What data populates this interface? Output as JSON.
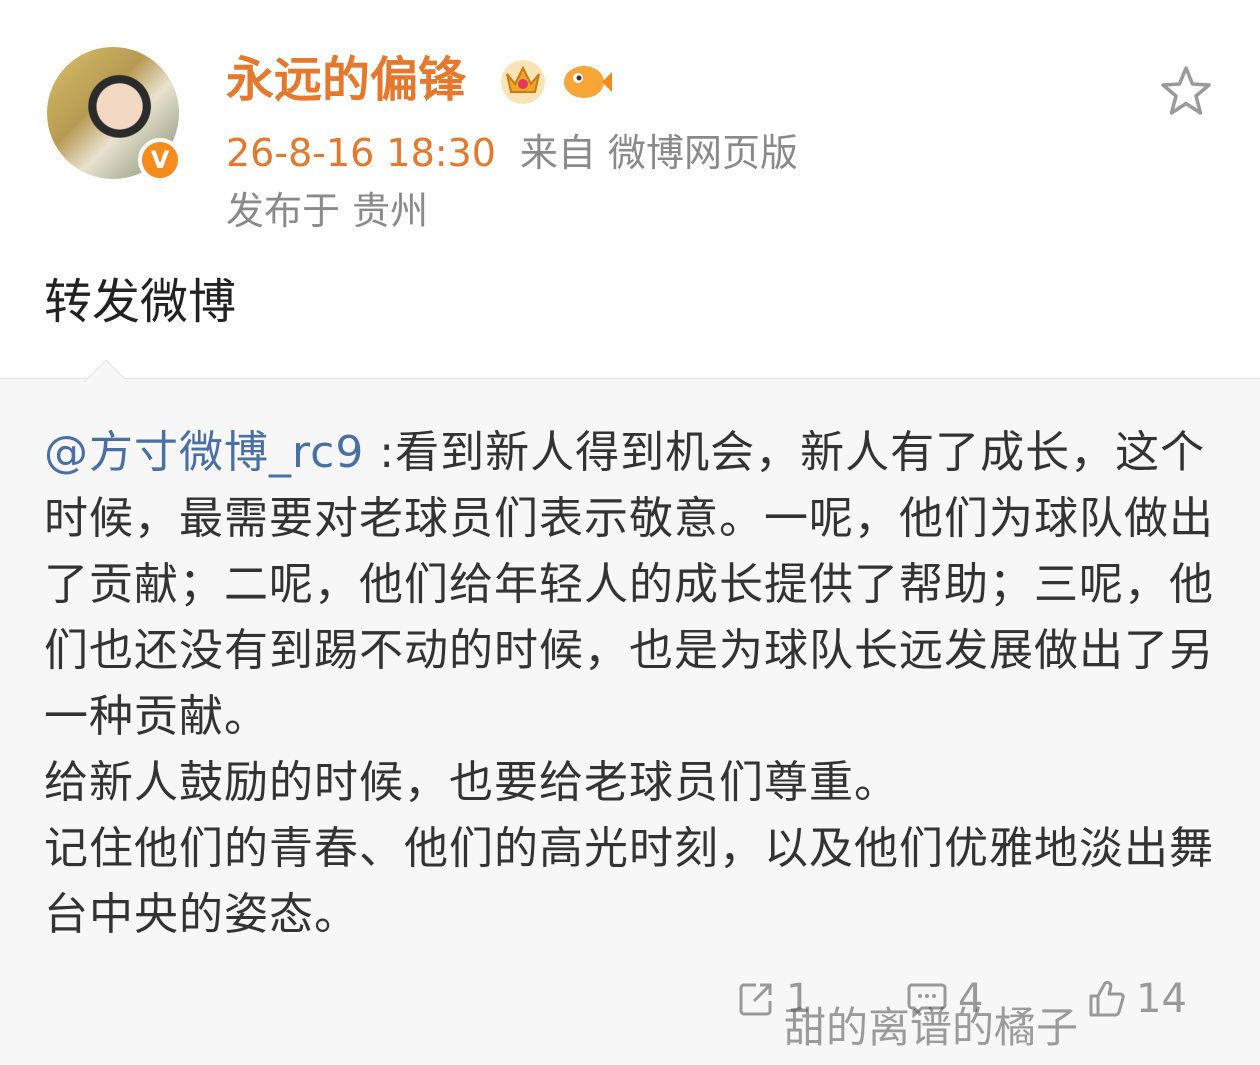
{
  "post": {
    "username": "永远的偏锋",
    "time": "26-8-16 18:30",
    "source": "来自 微博网页版",
    "location": "发布于 贵州",
    "repost_text": "转发微博"
  },
  "quoted": {
    "mention": "@方寸微博_rc9",
    "paragraph1": " :看到新人得到机会，新人有了成长，这个时候，最需要对老球员们表示敬意。一呢，他们为球队做出了贡献；二呢，他们给年轻人的成长提供了帮助；三呢，他们也还没有到踢不动的时候，也是为球队长远发展做出了另一种贡献。",
    "paragraph2": "给新人鼓励的时候，也要给老球员们尊重。",
    "paragraph3": "记住他们的青春、他们的高光时刻，以及他们优雅地淡出舞台中央的姿态。"
  },
  "actions": {
    "repost_count": "1",
    "comment_count": "4",
    "like_count": "14"
  },
  "watermark": "甜的离谱的橘子",
  "icons": {
    "verified": "verified-badge-icon",
    "crown": "crown-icon",
    "fish": "fish-icon",
    "star": "star-icon",
    "repost": "repost-icon",
    "comment": "comment-icon",
    "like": "thumbs-up-icon"
  },
  "colors": {
    "username": "#e5782c",
    "mention": "#4a6fa5",
    "meta_gray": "#8a8a8a",
    "quoted_bg": "#f7f7f7"
  }
}
